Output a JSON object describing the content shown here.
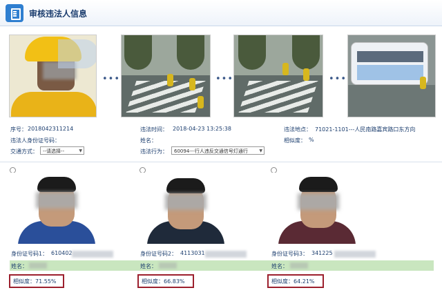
{
  "header": {
    "title": "审核违法人信息"
  },
  "photos": {
    "separator": "•••"
  },
  "violation": {
    "serial_label": "序号：",
    "serial_value": "2018042311214",
    "time_label": "违法时间：",
    "time_value": "2018-04-23 13:25:38",
    "location_label": "违法地点：",
    "location_value": "71021-1101---人民南路嘉宾路口东方向",
    "id_label": "违法人身份证号码：",
    "id_value": "",
    "name_label": "姓名：",
    "name_value": "",
    "similarity_label": "相似度：",
    "similarity_value": "%",
    "transport_label": "交通方式：",
    "transport_select": "--请选择--",
    "behavior_label": "违法行为：",
    "behavior_select": "60094---行人违反交通信号灯通行"
  },
  "candidates": [
    {
      "id_label": "身份证号码1：",
      "id_value": "610402",
      "name_label": "姓名：",
      "similarity_label": "相似度：",
      "similarity_value": "71.55%"
    },
    {
      "id_label": "身份证号码2：",
      "id_value": "4113031",
      "name_label": "姓名：",
      "similarity_label": "相似度：",
      "similarity_value": "66.83%"
    },
    {
      "id_label": "身份证号码3：",
      "id_value": "341225",
      "name_label": "姓名：",
      "similarity_label": "相似度：",
      "similarity_value": "64.21%"
    }
  ],
  "colors": {
    "accent": "#2f7fd0",
    "highlight_box": "#9c1f2d",
    "name_bar": "#c9e6bf",
    "text": "#1b3d6e"
  }
}
